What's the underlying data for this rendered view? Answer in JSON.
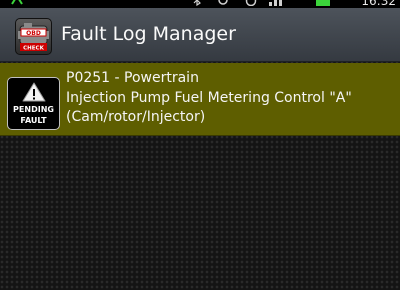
{
  "status_bar": {
    "time": "16:32",
    "icons": [
      "usb-debug-icon",
      "bluetooth-icon",
      "sync-icon",
      "alarm-icon",
      "signal-icon",
      "battery-icon"
    ],
    "battery_color": "#3bd53b"
  },
  "action_bar": {
    "app_icon_label_top": "OBD",
    "app_icon_label_bottom": "CHECK",
    "title": "Fault Log Manager"
  },
  "faults": [
    {
      "status_line1": "PENDING",
      "status_line2": "FAULT",
      "code_line": "P0251 - Powertrain",
      "description": "Injection Pump Fuel Metering Control \"A\" (Cam/rotor/Injector)",
      "row_color": "#5e5e00"
    }
  ]
}
